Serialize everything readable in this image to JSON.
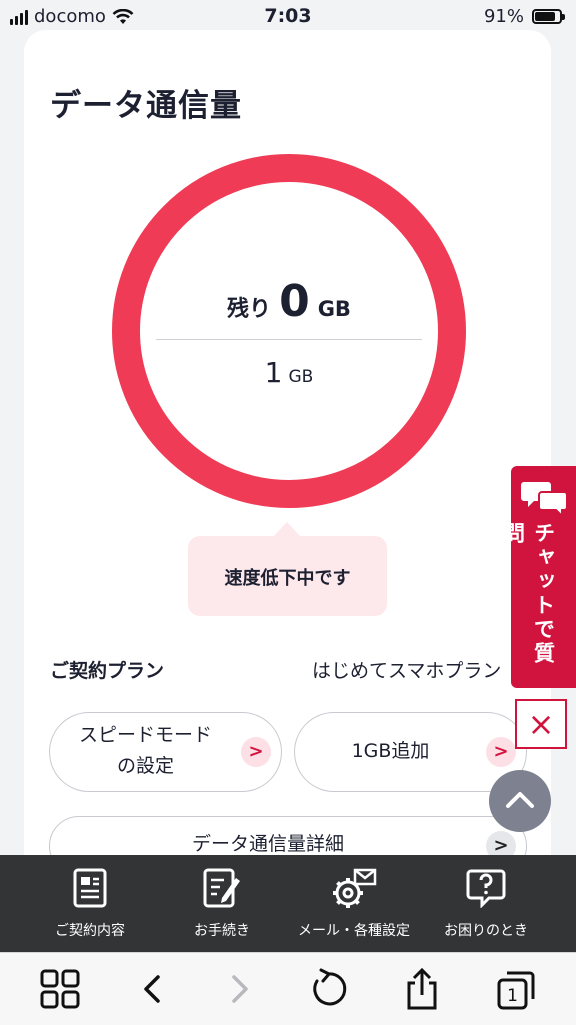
{
  "status_bar": {
    "carrier": "docomo",
    "time": "7:03",
    "battery": "91%",
    "battery_level": 0.91
  },
  "page": {
    "title": "データ通信量"
  },
  "usage": {
    "remaining_label": "残り",
    "remaining_value": "0",
    "remaining_unit": "GB",
    "total_value": "1",
    "total_unit": "GB",
    "ring_color": "#ef3b55"
  },
  "notice": {
    "text": "速度低下中です"
  },
  "contract": {
    "label": "ご契約プラン",
    "plan": "はじめてスマホプラン"
  },
  "actions": {
    "speed_mode": {
      "line1": "スピードモード",
      "line2": "の設定"
    },
    "add_data": {
      "label": "1GB追加"
    },
    "usage_detail": {
      "label": "データ通信量詳細"
    }
  },
  "chat": {
    "label": "チャットで質問",
    "close": "×"
  },
  "bottom_nav": [
    {
      "label": "ご契約内容",
      "icon": "document-icon"
    },
    {
      "label": "お手続き",
      "icon": "form-edit-icon"
    },
    {
      "label": "メール・各種設定",
      "icon": "gear-mail-icon"
    },
    {
      "label": "お困りのとき",
      "icon": "help-bubble-icon"
    }
  ],
  "browser_toolbar": {
    "tabs_count": "1"
  },
  "colors": {
    "accent": "#d1143d",
    "ring": "#ef3b55",
    "notice_bg": "#fde8ec",
    "nav_bg": "#333436"
  }
}
